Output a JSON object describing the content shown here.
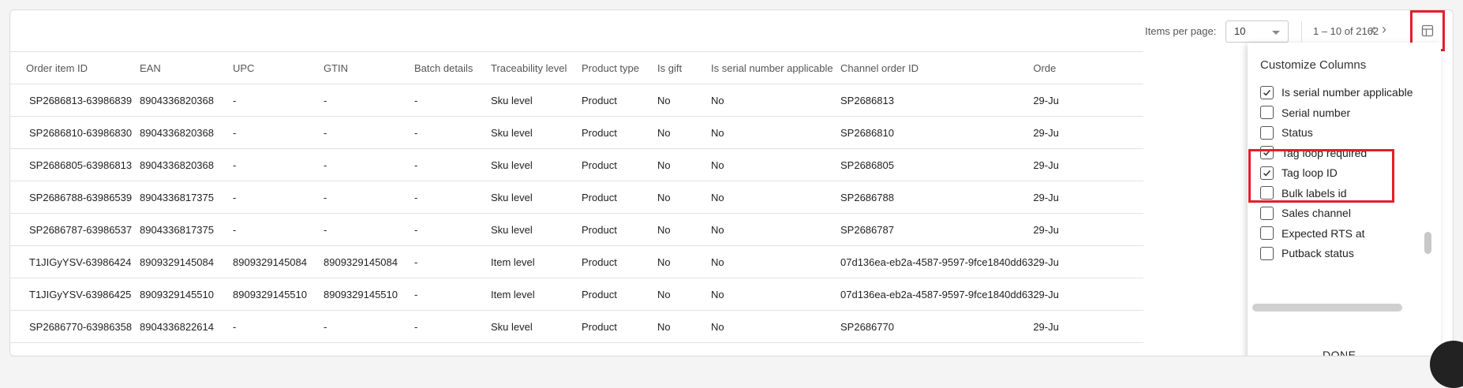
{
  "toolbar": {
    "items_per_page_label": "Items per page:",
    "items_per_page_value": "10",
    "range_text": "1 – 10 of 2162",
    "prev_glyph": "‹",
    "next_glyph": "›",
    "columns_icon": "table-columns-icon"
  },
  "table": {
    "columns": [
      "Order item ID",
      "EAN",
      "UPC",
      "GTIN",
      "Batch details",
      "Traceability level",
      "Product type",
      "Is gift",
      "Is serial number applicable",
      "Channel order ID",
      "Orde"
    ],
    "rows": [
      [
        "SP2686813-63986839",
        "8904336820368",
        "-",
        "-",
        "-",
        "Sku level",
        "Product",
        "No",
        "No",
        "SP2686813",
        "29-Ju"
      ],
      [
        "SP2686810-63986830",
        "8904336820368",
        "-",
        "-",
        "-",
        "Sku level",
        "Product",
        "No",
        "No",
        "SP2686810",
        "29-Ju"
      ],
      [
        "SP2686805-63986813",
        "8904336820368",
        "-",
        "-",
        "-",
        "Sku level",
        "Product",
        "No",
        "No",
        "SP2686805",
        "29-Ju"
      ],
      [
        "SP2686788-63986539",
        "8904336817375",
        "-",
        "-",
        "-",
        "Sku level",
        "Product",
        "No",
        "No",
        "SP2686788",
        "29-Ju"
      ],
      [
        "SP2686787-63986537",
        "8904336817375",
        "-",
        "-",
        "-",
        "Sku level",
        "Product",
        "No",
        "No",
        "SP2686787",
        "29-Ju"
      ],
      [
        "T1JIGyYSV-63986424",
        "8909329145084",
        "8909329145084",
        "8909329145084",
        "-",
        "Item level",
        "Product",
        "No",
        "No",
        "07d136ea-eb2a-4587-9597-9fce1840dd63",
        "29-Ju"
      ],
      [
        "T1JIGyYSV-63986425",
        "8909329145510",
        "8909329145510",
        "8909329145510",
        "-",
        "Item level",
        "Product",
        "No",
        "No",
        "07d136ea-eb2a-4587-9597-9fce1840dd63",
        "29-Ju"
      ],
      [
        "SP2686770-63986358",
        "8904336822614",
        "-",
        "-",
        "-",
        "Sku level",
        "Product",
        "No",
        "No",
        "SP2686770",
        "29-Ju"
      ]
    ]
  },
  "customize": {
    "title": "Customize Columns",
    "items": [
      {
        "label": "Is serial number applicable",
        "checked": true
      },
      {
        "label": "Serial number",
        "checked": false
      },
      {
        "label": "Status",
        "checked": false
      },
      {
        "label": "Tag loop required",
        "checked": true
      },
      {
        "label": "Tag loop ID",
        "checked": true
      },
      {
        "label": "Bulk labels id",
        "checked": false
      },
      {
        "label": "Sales channel",
        "checked": false
      },
      {
        "label": "Expected RTS at",
        "checked": false
      },
      {
        "label": "Putback status",
        "checked": false
      }
    ],
    "done_label": "DONE"
  },
  "colors": {
    "highlight": "#e21f2b",
    "border": "#e2e2e2"
  }
}
